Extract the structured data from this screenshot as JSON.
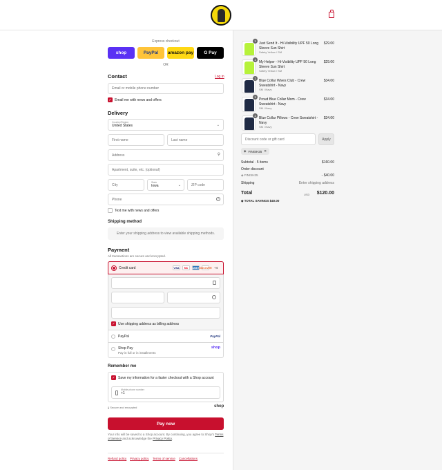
{
  "header": {
    "logo": "store-logo"
  },
  "express": {
    "title": "Express checkout",
    "buttons": [
      {
        "label": "shop",
        "color": "#5a31f4",
        "text_color": "#ffffff"
      },
      {
        "label": "PayPal",
        "color": "#ffc439",
        "text_color": "#253b80"
      },
      {
        "label": "amazon pay",
        "color": "#ffd814",
        "text_color": "#111111"
      },
      {
        "label": "G Pay",
        "color": "#000000",
        "text_color": "#ffffff"
      }
    ],
    "or": "OR"
  },
  "contact": {
    "title": "Contact",
    "login": "Log in",
    "email_placeholder": "Email or mobile phone number",
    "news_label": "Email me with news and offers"
  },
  "delivery": {
    "title": "Delivery",
    "country_label": "Country/Region",
    "country_value": "United States",
    "first_name": "First name",
    "last_name": "Last name",
    "address": "Address",
    "apartment": "Apartment, suite, etc. (optional)",
    "city": "City",
    "state_label": "State",
    "state_value": "Iowa",
    "zip": "ZIP code",
    "phone": "Phone",
    "text_label": "Text me with news and offers"
  },
  "shipping": {
    "title": "Shipping method",
    "message": "Enter your shipping address to view available shipping methods."
  },
  "payment": {
    "title": "Payment",
    "subtitle": "All transactions are secure and encrypted.",
    "credit_card": "Credit card",
    "cards": [
      {
        "label": "VISA",
        "color": "#ffffff",
        "text_color": "#1a1f71"
      },
      {
        "label": "MC",
        "color": "#ffffff",
        "text_color": "#eb001b"
      },
      {
        "label": "AMEX",
        "color": "#2e77bc",
        "text_color": "#ffffff"
      },
      {
        "label": "DISCOVER",
        "color": "#ffffff",
        "text_color": "#e55c20"
      }
    ],
    "more_cards": "+4",
    "billing_label": "Use shipping address as billing address",
    "paypal": "PayPal",
    "paypal_logo": "PayPal",
    "shoppay": "Shop Pay",
    "shoppay_sub": "Pay in full or in installments",
    "shoppay_logo": "shop"
  },
  "remember": {
    "title": "Remember me",
    "save_label": "Save my information for a faster checkout with a Shop account",
    "mobile_label": "Mobile phone number",
    "mobile_value": "+1",
    "secure": "Secure and encrypted",
    "shop_logo": "shop"
  },
  "pay_now": "Pay now",
  "legal": {
    "text1": "Your info will be saved to a Shop account. By continuing, you agree to Shop's",
    "tos": "Terms of Service",
    "text2": "and acknowledge the",
    "privacy": "Privacy Policy",
    "end": "."
  },
  "footer": [
    "Refund policy",
    "Privacy policy",
    "Terms of service",
    "Cancellations"
  ],
  "cart": {
    "items": [
      {
        "qty": "1",
        "name": "Just Send It - Hi-Visibility UPF 50 Long Sleeve Sun Shirt",
        "variant": "Safety Yellow / SM",
        "price": "$29.00",
        "color": "#b6f23a"
      },
      {
        "qty": "1",
        "name": "My Helper - Hi-Visibility UPF 50 Long Sleeve Sun Shirt",
        "variant": "Safety Yellow / SM",
        "price": "$29.00",
        "color": "#b6f23a"
      },
      {
        "qty": "1",
        "name": "Blue Collar Wives Club - Crew Sweatshirt - Navy",
        "variant": "SM / Navy",
        "price": "$34.00",
        "color": "#1f2a44"
      },
      {
        "qty": "1",
        "name": "Proud Blue Collar Mom - Crew Sweatshirt - Navy",
        "variant": "SM / Navy",
        "price": "$34.00",
        "color": "#1f2a44"
      },
      {
        "qty": "1",
        "name": "Blue Collar Pillows - Crew Sweatshirt - Navy",
        "variant": "SM / Navy",
        "price": "$34.00",
        "color": "#1f2a44"
      }
    ],
    "discount_placeholder": "Discount code or gift card",
    "apply": "Apply",
    "code_tag": "FINISH25",
    "subtotal_label": "Subtotal · 5 items",
    "subtotal": "$160.00",
    "order_discount": "Order discount",
    "code_line": "FINISH25",
    "discount_value": "- $40.00",
    "shipping_label": "Shipping",
    "shipping_value": "Enter shipping address",
    "total_label": "Total",
    "currency": "USD",
    "total": "$120.00",
    "savings_label": "TOTAL SAVINGS",
    "savings": "$40.00"
  }
}
